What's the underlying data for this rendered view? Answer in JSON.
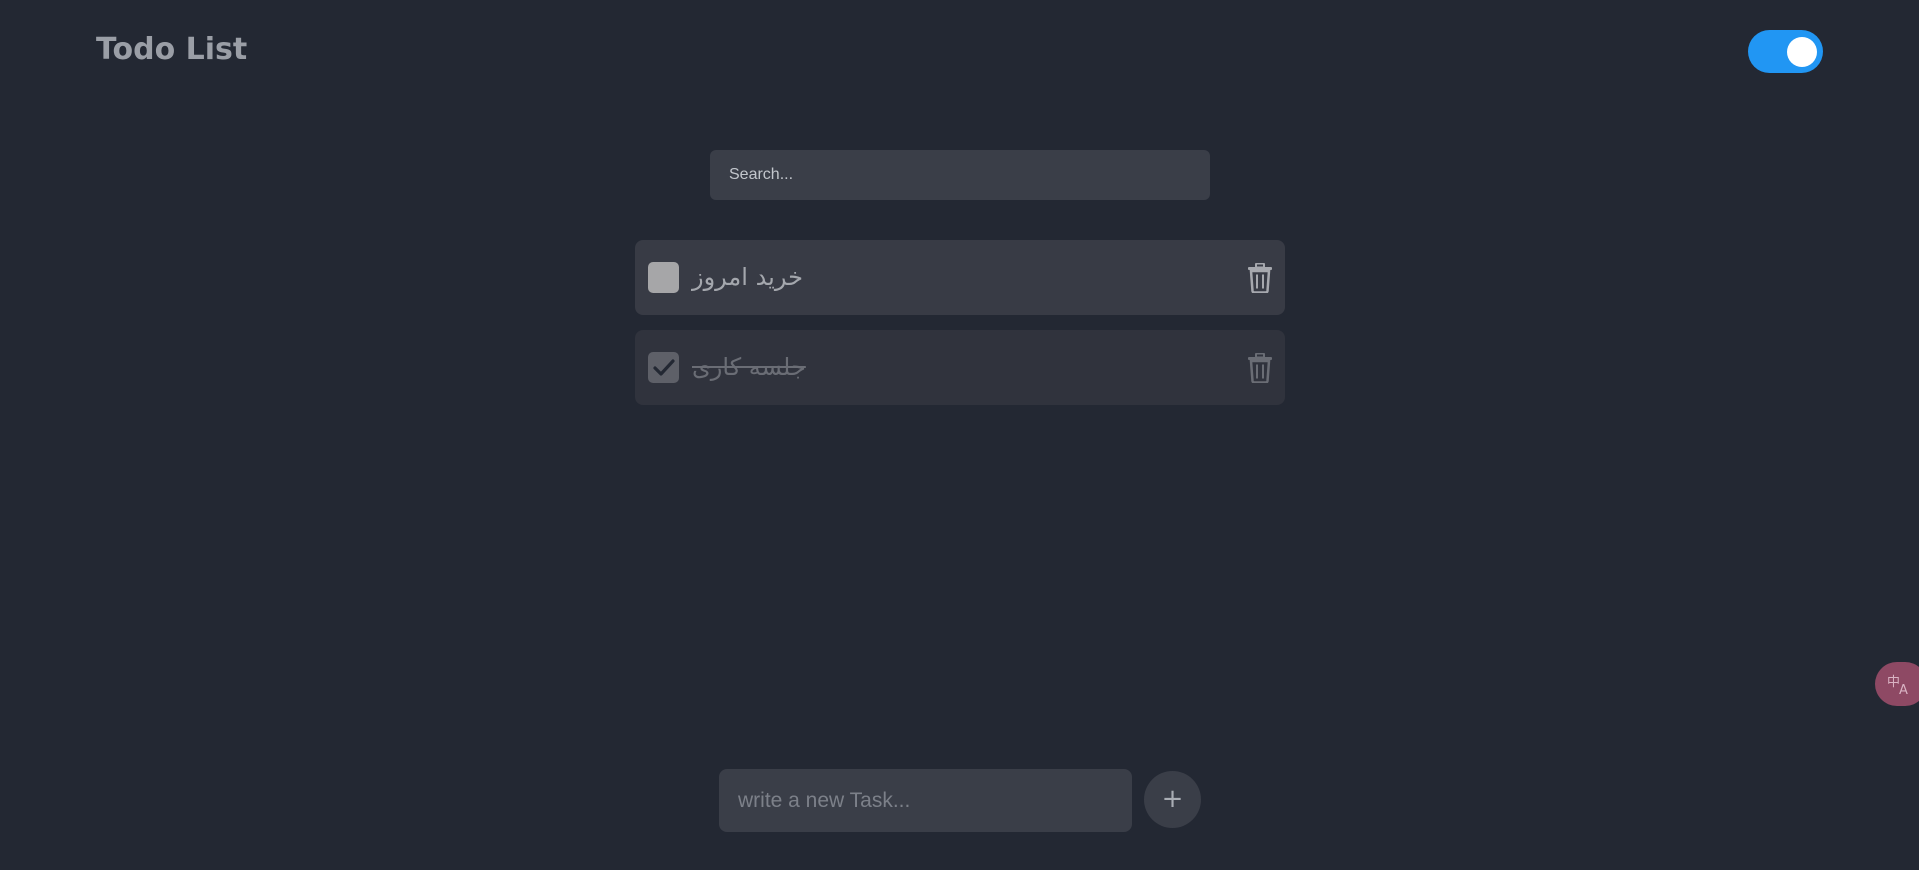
{
  "header": {
    "title": "Todo List",
    "theme_toggle": {
      "state": "on",
      "color": "#2196f3"
    }
  },
  "search": {
    "placeholder": "Search..."
  },
  "todos": [
    {
      "text": "خرید امروز",
      "done": false,
      "delete_icon": "trash-icon"
    },
    {
      "text": "جلسه کاری",
      "done": true,
      "delete_icon": "trash-icon"
    }
  ],
  "new_task": {
    "placeholder": "write a new Task...",
    "add_label": "+"
  },
  "floating_widget": {
    "icon": "translate-icon",
    "color": "#8e4964"
  }
}
